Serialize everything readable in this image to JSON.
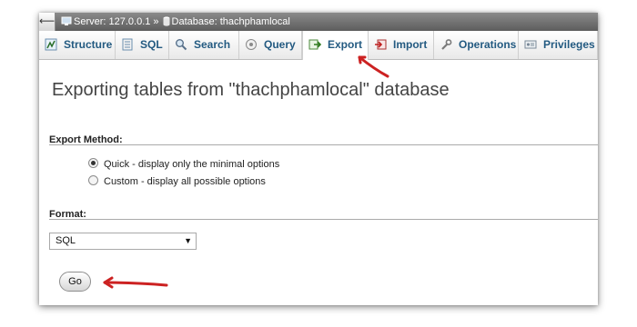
{
  "breadcrumb": {
    "server_label": "Server: 127.0.0.1",
    "separator": "»",
    "database_label": "Database: thachphamlocal"
  },
  "tabs": [
    {
      "label": "Structure",
      "icon": "structure-icon"
    },
    {
      "label": "SQL",
      "icon": "sql-icon"
    },
    {
      "label": "Search",
      "icon": "search-icon"
    },
    {
      "label": "Query",
      "icon": "query-icon"
    },
    {
      "label": "Export",
      "icon": "export-icon",
      "active": true
    },
    {
      "label": "Import",
      "icon": "import-icon"
    },
    {
      "label": "Operations",
      "icon": "operations-icon"
    },
    {
      "label": "Privileges",
      "icon": "privileges-icon"
    }
  ],
  "page": {
    "heading": "Exporting tables from \"thachphamlocal\" database"
  },
  "export_method": {
    "label": "Export Method:",
    "options": [
      {
        "label": "Quick - display only the minimal options",
        "checked": true
      },
      {
        "label": "Custom - display all possible options",
        "checked": false
      }
    ]
  },
  "format": {
    "label": "Format:",
    "selected": "SQL"
  },
  "go_button": {
    "label": "Go"
  },
  "colors": {
    "tab_text": "#235a81",
    "annotation_arrow": "#cc2222",
    "heading_text": "#444444"
  }
}
